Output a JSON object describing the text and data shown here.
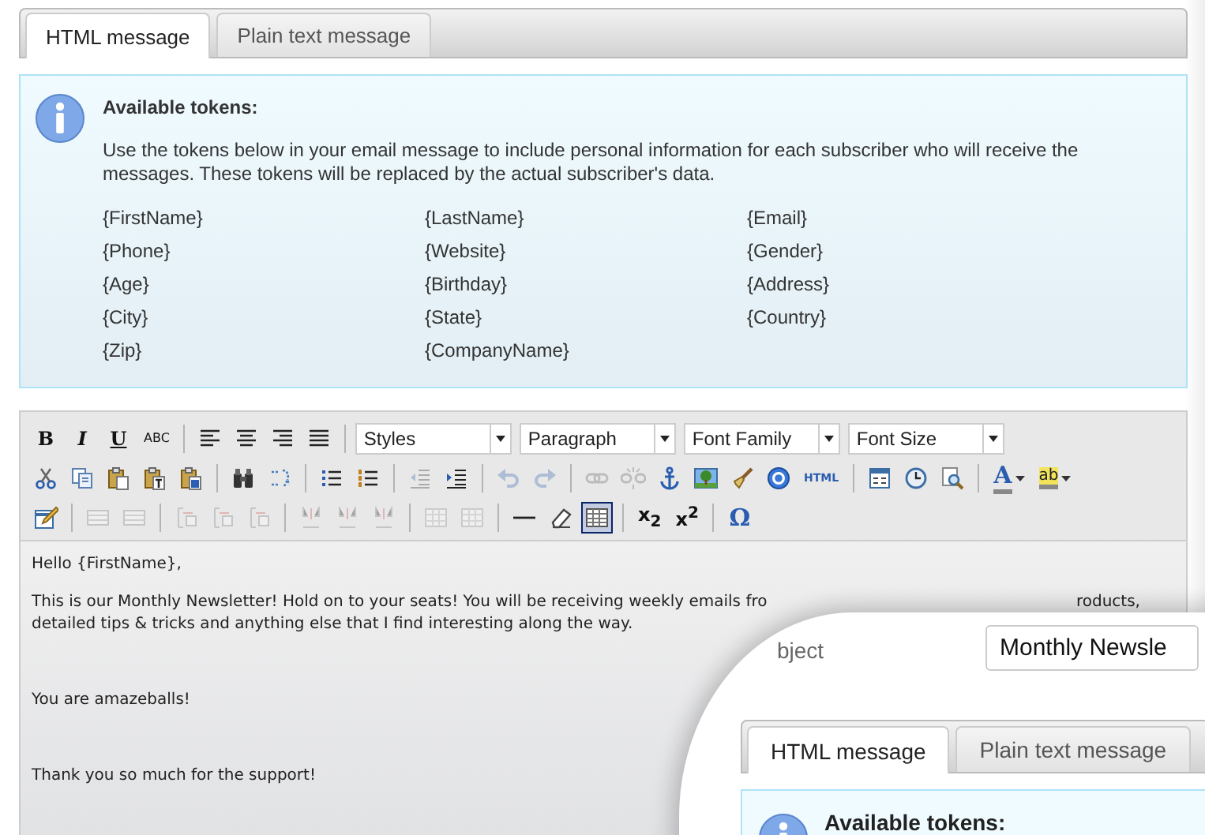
{
  "tabs": [
    {
      "label": "HTML message",
      "selected": true
    },
    {
      "label": "Plain text message",
      "selected": false
    }
  ],
  "info": {
    "title": "Available tokens:",
    "text": "Use the tokens below in your email message to include personal information for each subscriber who will receive the messages. These tokens will be replaced by the actual subscriber's data.",
    "tokens": [
      "{FirstName}",
      "{LastName}",
      "{Email}",
      "{Phone}",
      "{Website}",
      "{Gender}",
      "{Age}",
      "{Birthday}",
      "{Address}",
      "{City}",
      "{State}",
      "{Country}",
      "{Zip}",
      "{CompanyName}"
    ]
  },
  "toolbar": [
    {
      "items": [
        {
          "kind": "text",
          "label": "B",
          "disabled": false,
          "active": false
        },
        {
          "kind": "text",
          "label": "I",
          "disabled": false,
          "active": false
        },
        {
          "kind": "text",
          "label": "U",
          "disabled": false,
          "active": false
        },
        {
          "kind": "text",
          "label": "ABC",
          "disabled": false,
          "active": false
        },
        {
          "kind": "separator"
        },
        {
          "kind": "icon",
          "disabled": false,
          "active": false
        },
        {
          "kind": "icon",
          "disabled": false,
          "active": false
        },
        {
          "kind": "icon",
          "disabled": false,
          "active": false
        },
        {
          "kind": "icon",
          "disabled": false,
          "active": false
        },
        {
          "kind": "separator"
        },
        {
          "kind": "select",
          "label": "Styles"
        },
        {
          "kind": "select",
          "label": "Paragraph"
        },
        {
          "kind": "select",
          "label": "Font Family"
        },
        {
          "kind": "select",
          "label": "Font Size"
        }
      ]
    },
    {
      "items": [
        {
          "kind": "icon",
          "disabled": false,
          "active": false
        },
        {
          "kind": "icon",
          "disabled": false,
          "active": false
        },
        {
          "kind": "icon",
          "disabled": false,
          "active": false
        },
        {
          "kind": "icon",
          "disabled": false,
          "active": false
        },
        {
          "kind": "icon",
          "disabled": false,
          "active": false
        },
        {
          "kind": "separator"
        },
        {
          "kind": "icon",
          "disabled": false,
          "active": false
        },
        {
          "kind": "icon",
          "disabled": false,
          "active": false
        },
        {
          "kind": "separator"
        },
        {
          "kind": "icon",
          "disabled": false,
          "active": false
        },
        {
          "kind": "icon",
          "disabled": false,
          "active": false
        },
        {
          "kind": "separator"
        },
        {
          "kind": "icon",
          "disabled": true,
          "active": false
        },
        {
          "kind": "icon",
          "disabled": false,
          "active": false
        },
        {
          "kind": "separator"
        },
        {
          "kind": "icon",
          "disabled": true,
          "active": false
        },
        {
          "kind": "icon",
          "disabled": true,
          "active": false
        },
        {
          "kind": "separator"
        },
        {
          "kind": "icon",
          "disabled": true,
          "active": false
        },
        {
          "kind": "icon",
          "disabled": true,
          "active": false
        },
        {
          "kind": "icon",
          "disabled": false,
          "active": false
        },
        {
          "kind": "icon",
          "disabled": false,
          "active": false
        },
        {
          "kind": "icon",
          "disabled": false,
          "active": false
        },
        {
          "kind": "icon",
          "disabled": false,
          "active": false
        },
        {
          "kind": "text",
          "label": "HTML",
          "disabled": false,
          "active": false
        },
        {
          "kind": "separator"
        },
        {
          "kind": "icon",
          "disabled": false,
          "active": false
        },
        {
          "kind": "icon",
          "disabled": false,
          "active": false
        },
        {
          "kind": "icon",
          "disabled": false,
          "active": false
        },
        {
          "kind": "separator"
        },
        {
          "kind": "split",
          "label": "A",
          "disabled": false,
          "active": false
        },
        {
          "kind": "split",
          "label": "ab",
          "disabled": false,
          "active": false
        }
      ]
    },
    {
      "items": [
        {
          "kind": "icon",
          "disabled": false,
          "active": false
        },
        {
          "kind": "separator"
        },
        {
          "kind": "icon",
          "disabled": true,
          "active": false
        },
        {
          "kind": "icon",
          "disabled": true,
          "active": false
        },
        {
          "kind": "separator"
        },
        {
          "kind": "icon",
          "disabled": true,
          "active": false
        },
        {
          "kind": "icon",
          "disabled": true,
          "active": false
        },
        {
          "kind": "icon",
          "disabled": true,
          "active": false
        },
        {
          "kind": "separator"
        },
        {
          "kind": "icon",
          "disabled": true,
          "active": false
        },
        {
          "kind": "icon",
          "disabled": true,
          "active": false
        },
        {
          "kind": "icon",
          "disabled": true,
          "active": false
        },
        {
          "kind": "separator"
        },
        {
          "kind": "icon",
          "disabled": true,
          "active": false
        },
        {
          "kind": "icon",
          "disabled": true,
          "active": false
        },
        {
          "kind": "separator"
        },
        {
          "kind": "icon",
          "disabled": false,
          "active": false
        },
        {
          "kind": "icon",
          "disabled": false,
          "active": false
        },
        {
          "kind": "icon",
          "disabled": false,
          "active": true
        },
        {
          "kind": "separator"
        },
        {
          "kind": "text",
          "label": "x$_{2}$",
          "disabled": false,
          "active": false
        },
        {
          "kind": "text",
          "label": "x$^{2}$",
          "disabled": false,
          "active": false
        },
        {
          "kind": "separator"
        },
        {
          "kind": "text",
          "label": "Ω",
          "disabled": false,
          "active": false
        }
      ]
    }
  ],
  "editor": {
    "paragraphs": [
      {
        "lines": [
          [
            "Hello {FirstName},"
          ]
        ]
      },
      {
        "lines": [
          [
            "This is our Monthly Newsletter! Hold on to your seats! You will be receiving weekly emails fro",
            "roducts,"
          ],
          [
            "detailed tips & tricks and anything else that I find interesting along the way."
          ]
        ]
      },
      {
        "lines": [
          [
            "You are amazeballs!"
          ]
        ]
      },
      {
        "lines": [
          [
            "Thank you so much for the support!"
          ]
        ]
      }
    ]
  },
  "magnifier": {
    "subject_label": "bject",
    "subject_value": "Monthly Newsle",
    "tabs": [
      {
        "label": "HTML message",
        "selected": true
      },
      {
        "label": "Plain text message",
        "selected": false
      }
    ],
    "info_title": "Available tokens:"
  }
}
